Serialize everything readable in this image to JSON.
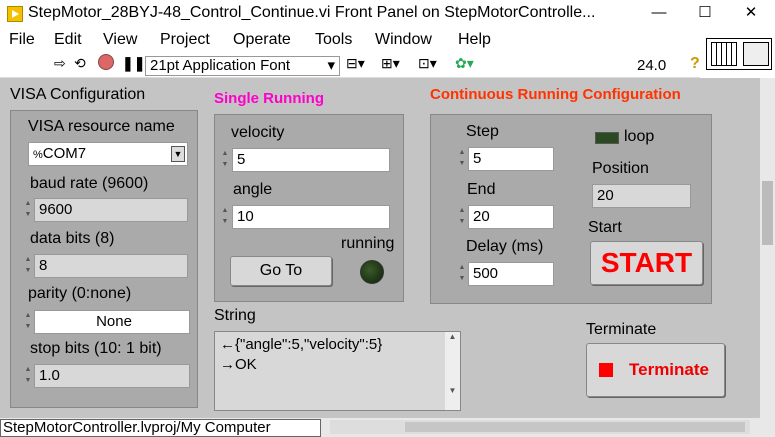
{
  "window": {
    "title": "StepMotor_28BYJ-48_Control_Continue.vi Front Panel on StepMotorControlle...",
    "minimize": "—",
    "maximize": "☐",
    "close": "✕"
  },
  "menu": [
    "File",
    "Edit",
    "View",
    "Project",
    "Operate",
    "Tools",
    "Window",
    "Help"
  ],
  "toolbar": {
    "font": "21pt Application Font",
    "font_arrow": "▾",
    "zoom": "24.0",
    "help": "?"
  },
  "visa": {
    "section_label": "VISA Configuration",
    "resource_label": "VISA resource name",
    "resource_value": "COM7",
    "resource_prefix": "%",
    "baud_label": "baud rate (9600)",
    "baud_value": "9600",
    "data_bits_label": "data bits (8)",
    "data_bits_value": "8",
    "parity_label": "parity (0:none)",
    "parity_value": "None",
    "stop_bits_label": "stop bits (10: 1 bit)",
    "stop_bits_value": "1.0"
  },
  "single": {
    "section_label": "Single Running",
    "velocity_label": "velocity",
    "velocity_value": "5",
    "angle_label": "angle",
    "angle_value": "10",
    "goto_label": "Go To",
    "running_label": "running",
    "accent": "#ff00cc"
  },
  "continuous": {
    "section_label": "Continuous Running Configuration",
    "step_label": "Step",
    "step_value": "5",
    "end_label": "End",
    "end_value": "20",
    "delay_label": "Delay (ms)",
    "delay_value": "500",
    "loop_label": "loop",
    "position_label": "Position",
    "position_value": "20",
    "start_label": "Start",
    "start_button": "START",
    "accent": "#ff3300"
  },
  "string": {
    "label": "String",
    "line1": "←{\"angle\":5,\"velocity\":5}",
    "line2": "→OK"
  },
  "terminate": {
    "label": "Terminate",
    "button": "Terminate"
  },
  "status": {
    "path": "StepMotorController.lvproj/My Computer"
  }
}
